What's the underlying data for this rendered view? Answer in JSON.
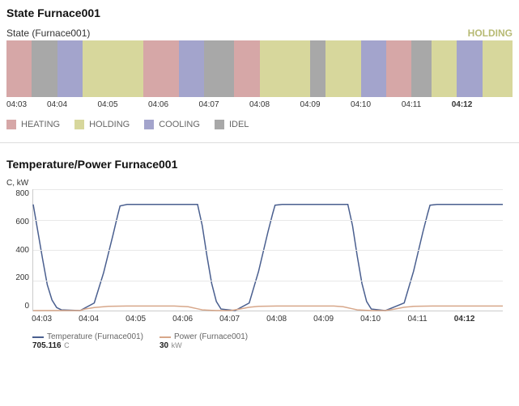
{
  "state_panel": {
    "title": "State Furnace001",
    "series_label": "State (Furnace001)",
    "current_state": "HOLDING",
    "legend": [
      {
        "label": "HEATING",
        "color": "#d6a7a7"
      },
      {
        "label": "HOLDING",
        "color": "#d7d79c"
      },
      {
        "label": "COOLING",
        "color": "#a3a4cc"
      },
      {
        "label": "IDEL",
        "color": "#a8a8a8"
      }
    ]
  },
  "line_panel": {
    "title": "Temperature/Power Furnace001",
    "y_axis_label": "C, kW",
    "y_ticks": [
      800,
      600,
      400,
      200,
      0
    ],
    "series": [
      {
        "name": "Temperature (Furnace001)",
        "color": "#4a5f8f",
        "value": "705.116",
        "unit": "C"
      },
      {
        "name": "Power (Furnace001)",
        "color": "#d7a78a",
        "value": "30",
        "unit": "kW"
      }
    ]
  },
  "x_ticks": [
    "04:03",
    "04:04",
    "04:05",
    "04:06",
    "04:07",
    "04:08",
    "04:09",
    "04:10",
    "04:11",
    "04:12"
  ],
  "chart_data": [
    {
      "type": "bar",
      "title": "State Furnace001",
      "x_range": [
        "04:03",
        "04:13"
      ],
      "segments": [
        {
          "state": "HEATING",
          "start": 0.0,
          "end": 0.5
        },
        {
          "state": "IDEL",
          "start": 0.5,
          "end": 1.0
        },
        {
          "state": "COOLING",
          "start": 1.0,
          "end": 1.5
        },
        {
          "state": "HOLDING",
          "start": 1.5,
          "end": 2.7
        },
        {
          "state": "HEATING",
          "start": 2.7,
          "end": 3.4
        },
        {
          "state": "COOLING",
          "start": 3.4,
          "end": 3.9
        },
        {
          "state": "IDEL",
          "start": 3.9,
          "end": 4.5
        },
        {
          "state": "HEATING",
          "start": 4.5,
          "end": 5.0
        },
        {
          "state": "HOLDING",
          "start": 5.0,
          "end": 6.0
        },
        {
          "state": "IDEL",
          "start": 6.0,
          "end": 6.3
        },
        {
          "state": "HOLDING",
          "start": 6.3,
          "end": 7.0
        },
        {
          "state": "COOLING",
          "start": 7.0,
          "end": 7.5
        },
        {
          "state": "HEATING",
          "start": 7.5,
          "end": 8.0
        },
        {
          "state": "IDEL",
          "start": 8.0,
          "end": 8.4
        },
        {
          "state": "HOLDING",
          "start": 8.4,
          "end": 8.9
        },
        {
          "state": "COOLING",
          "start": 8.9,
          "end": 9.4
        },
        {
          "state": "HOLDING",
          "start": 9.4,
          "end": 10.0
        }
      ],
      "state_colors": {
        "HEATING": "#d6a7a7",
        "HOLDING": "#d7d79c",
        "COOLING": "#a3a4cc",
        "IDEL": "#a8a8a8"
      }
    },
    {
      "type": "line",
      "title": "Temperature/Power Furnace001",
      "ylabel": "C, kW",
      "ylim": [
        0,
        800
      ],
      "x_range": [
        "04:02.8",
        "04:12.8"
      ],
      "series": [
        {
          "name": "Temperature (Furnace001)",
          "color": "#4a5f8f",
          "x": [
            0.0,
            0.1,
            0.2,
            0.3,
            0.4,
            0.5,
            0.6,
            1.0,
            1.3,
            1.5,
            1.7,
            1.8,
            1.85,
            2.0,
            2.3,
            2.6,
            3.0,
            3.3,
            3.5,
            3.6,
            3.7,
            3.8,
            3.9,
            4.0,
            4.3,
            4.6,
            4.8,
            5.0,
            5.1,
            5.15,
            5.3,
            5.7,
            6.1,
            6.5,
            6.7,
            6.8,
            6.9,
            7.0,
            7.1,
            7.2,
            7.5,
            7.9,
            8.1,
            8.3,
            8.4,
            8.45,
            8.6,
            9.0,
            9.4,
            9.8,
            10.0
          ],
          "y": [
            700,
            520,
            340,
            170,
            70,
            20,
            5,
            0,
            50,
            250,
            500,
            630,
            690,
            700,
            700,
            700,
            700,
            700,
            700,
            560,
            360,
            180,
            60,
            10,
            0,
            50,
            260,
            520,
            640,
            695,
            700,
            700,
            700,
            700,
            700,
            560,
            360,
            180,
            60,
            10,
            0,
            50,
            260,
            520,
            640,
            695,
            700,
            700,
            700,
            700,
            700
          ]
        },
        {
          "name": "Power (Furnace001)",
          "color": "#d7a78a",
          "x": [
            0.0,
            0.3,
            0.6,
            1.0,
            1.1,
            1.3,
            1.6,
            2.0,
            2.5,
            3.0,
            3.3,
            3.5,
            3.6,
            3.9,
            4.2,
            4.4,
            4.6,
            4.8,
            5.2,
            5.8,
            6.4,
            6.6,
            6.8,
            6.9,
            7.2,
            7.5,
            7.7,
            7.9,
            8.1,
            8.5,
            9.0,
            9.5,
            10.0
          ],
          "y": [
            0,
            0,
            0,
            0,
            10,
            20,
            28,
            30,
            30,
            30,
            25,
            12,
            5,
            0,
            0,
            10,
            22,
            28,
            30,
            30,
            30,
            25,
            12,
            5,
            0,
            0,
            10,
            22,
            28,
            30,
            30,
            30,
            30
          ]
        }
      ]
    }
  ]
}
